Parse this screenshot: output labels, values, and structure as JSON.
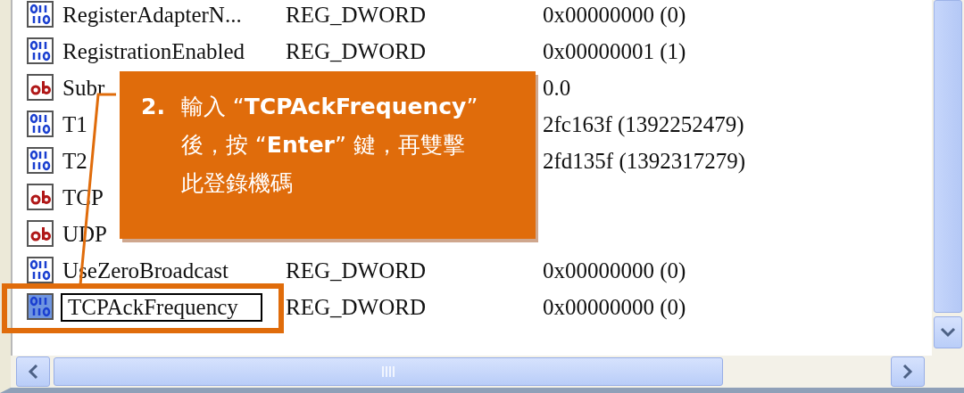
{
  "rows": [
    {
      "kind": "dword",
      "name": "RegisterAdapterN...",
      "type": "REG_DWORD",
      "data": "0x00000000 (0)",
      "selected": false,
      "editing": false
    },
    {
      "kind": "dword",
      "name": "RegistrationEnabled",
      "type": "REG_DWORD",
      "data": "0x00000001 (1)",
      "selected": false,
      "editing": false
    },
    {
      "kind": "string",
      "name": "Subr",
      "type": "",
      "data": "0.0",
      "selected": false,
      "editing": false
    },
    {
      "kind": "dword",
      "name": "T1",
      "type": "",
      "data": "2fc163f (1392252479)",
      "selected": false,
      "editing": false
    },
    {
      "kind": "dword",
      "name": "T2",
      "type": "",
      "data": "2fd135f (1392317279)",
      "selected": false,
      "editing": false
    },
    {
      "kind": "string",
      "name": "TCP",
      "type": "",
      "data": "",
      "selected": false,
      "editing": false
    },
    {
      "kind": "string",
      "name": "UDP",
      "type": "",
      "data": "",
      "selected": false,
      "editing": false
    },
    {
      "kind": "dword",
      "name": "UseZeroBroadcast",
      "type": "REG_DWORD",
      "data": "0x00000000 (0)",
      "selected": false,
      "editing": false
    },
    {
      "kind": "dword",
      "name": "TCPAckFrequency",
      "type": "REG_DWORD",
      "data": "0x00000000 (0)",
      "selected": true,
      "editing": true
    }
  ],
  "callout": {
    "number": "2.",
    "lines": [
      "輸入 “**TCPAckFrequency**”",
      "後，按 “**Enter**” 鍵，再雙擊",
      "此登錄機碼"
    ]
  }
}
